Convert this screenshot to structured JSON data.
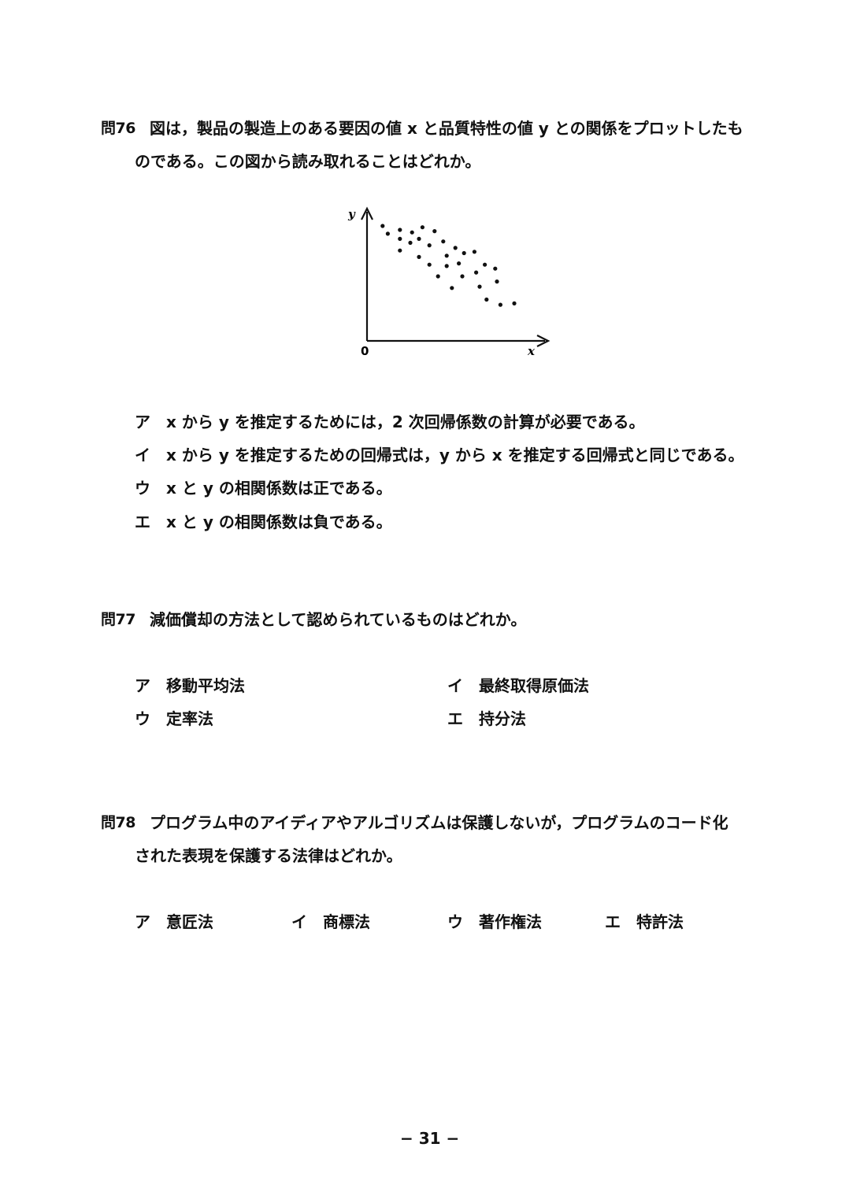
{
  "q76": {
    "number": "問76",
    "line1": "図は，製品の製造上のある要因の値 x と品質特性の値 y との関係をプロットしたも",
    "line2": "のである。この図から読み取れることはどれか。",
    "options": [
      {
        "label": "ア",
        "text": "x から y を推定するためには，2 次回帰係数の計算が必要である。"
      },
      {
        "label": "イ",
        "text": "x から y を推定するための回帰式は，y から x を推定する回帰式と同じである。"
      },
      {
        "label": "ウ",
        "text": "x と y の相関係数は正である。"
      },
      {
        "label": "エ",
        "text": "x と y の相関係数は負である。"
      }
    ]
  },
  "chart_data": {
    "type": "scatter",
    "xlabel": "x",
    "ylabel": "y",
    "origin_label": "0",
    "grid": false,
    "xlim": [
      0,
      10
    ],
    "ylim": [
      0,
      10
    ],
    "points": [
      [
        0.9,
        8.9
      ],
      [
        1.2,
        8.3
      ],
      [
        1.9,
        8.6
      ],
      [
        2.6,
        8.4
      ],
      [
        3.2,
        8.8
      ],
      [
        3.9,
        8.5
      ],
      [
        1.9,
        7.9
      ],
      [
        2.5,
        7.6
      ],
      [
        3.0,
        7.9
      ],
      [
        3.6,
        7.4
      ],
      [
        4.4,
        7.7
      ],
      [
        5.1,
        7.2
      ],
      [
        1.9,
        7.0
      ],
      [
        3.0,
        6.5
      ],
      [
        4.6,
        6.6
      ],
      [
        5.6,
        6.8
      ],
      [
        6.2,
        6.9
      ],
      [
        3.6,
        5.9
      ],
      [
        4.6,
        5.8
      ],
      [
        5.3,
        6.0
      ],
      [
        6.8,
        5.9
      ],
      [
        7.4,
        5.6
      ],
      [
        4.1,
        5.0
      ],
      [
        5.5,
        5.0
      ],
      [
        6.3,
        5.3
      ],
      [
        7.5,
        4.6
      ],
      [
        6.5,
        4.2
      ],
      [
        4.9,
        4.1
      ],
      [
        6.9,
        3.2
      ],
      [
        7.7,
        2.8
      ],
      [
        8.5,
        2.9
      ]
    ]
  },
  "q77": {
    "number": "問77",
    "text": "減価償却の方法として認められているものはどれか。",
    "options": [
      {
        "label": "ア",
        "text": "移動平均法"
      },
      {
        "label": "イ",
        "text": "最終取得原価法"
      },
      {
        "label": "ウ",
        "text": "定率法"
      },
      {
        "label": "エ",
        "text": "持分法"
      }
    ]
  },
  "q78": {
    "number": "問78",
    "line1": "プログラム中のアイディアやアルゴリズムは保護しないが，プログラムのコード化",
    "line2": "された表現を保護する法律はどれか。",
    "options": [
      {
        "label": "ア",
        "text": "意匠法"
      },
      {
        "label": "イ",
        "text": "商標法"
      },
      {
        "label": "ウ",
        "text": "著作権法"
      },
      {
        "label": "エ",
        "text": "特許法"
      }
    ]
  },
  "footer": {
    "page": "− 31 −"
  }
}
